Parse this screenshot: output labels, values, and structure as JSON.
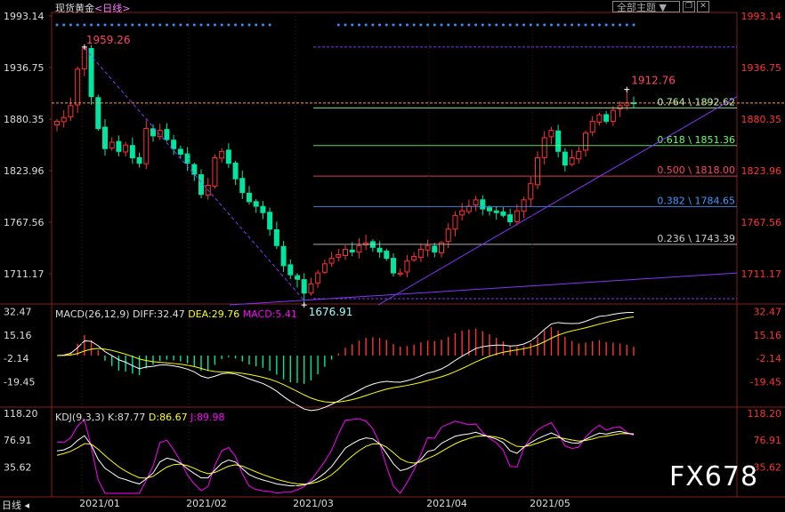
{
  "header": {
    "instrument": "现货黄金",
    "period": "<日线>",
    "menu_label": "全部主题",
    "menu_arrow": "▼",
    "period_tab": "日线"
  },
  "watermark": "FX678",
  "colors": {
    "up": "#ff3232",
    "down": "#00e6a0",
    "dif": "#ffffff",
    "dea": "#ffff00",
    "macd_label": "#ff00ff",
    "k": "#ffffff",
    "d": "#ffff00",
    "j": "#ff00ff",
    "trend": "#8833ff",
    "axis": "#ff3232"
  },
  "chart_data": [
    {
      "type": "candlestick",
      "title": "现货黄金<日线>",
      "ylim": [
        1680,
        1993.14
      ],
      "y_ticks": [
        "1993.14",
        "1936.75",
        "1880.35",
        "1823.96",
        "1767.56",
        "1711.17"
      ],
      "x_ticks": [
        "2021/01",
        "2021/02",
        "2021/03",
        "2021/04",
        "2021/05"
      ],
      "annotations": {
        "high": "1959.26",
        "low": "1676.91",
        "last_high": "1912.76"
      },
      "close_path": [
        1878,
        1882,
        1895,
        1935,
        1958,
        1905,
        1870,
        1848,
        1855,
        1845,
        1852,
        1838,
        1832,
        1870,
        1862,
        1868,
        1858,
        1848,
        1842,
        1832,
        1820,
        1798,
        1808,
        1838,
        1845,
        1832,
        1815,
        1800,
        1790,
        1785,
        1778,
        1760,
        1742,
        1720,
        1710,
        1705,
        1690,
        1700,
        1712,
        1722,
        1728,
        1732,
        1738,
        1735,
        1742,
        1745,
        1740,
        1735,
        1728,
        1712,
        1712,
        1725,
        1730,
        1738,
        1742,
        1735,
        1745,
        1760,
        1775,
        1780,
        1785,
        1792,
        1782,
        1780,
        1778,
        1775,
        1768,
        1780,
        1792,
        1810,
        1838,
        1860,
        1868,
        1845,
        1830,
        1838,
        1845,
        1865,
        1878,
        1885,
        1878,
        1890,
        1895,
        1898,
        1898
      ],
      "fibonacci": [
        {
          "label": "0.764 \\ 1892.62",
          "value": 1892.62,
          "color": "#b0ffb0"
        },
        {
          "label": "0.618 \\ 1851.36",
          "value": 1851.36,
          "color": "#66ff66"
        },
        {
          "label": "0.500 \\ 1818.00",
          "value": 1818.0,
          "color": "#ff4466"
        },
        {
          "label": "0.382 \\ 1784.65",
          "value": 1784.65,
          "color": "#4499ff"
        },
        {
          "label": "0.236 \\ 1743.39",
          "value": 1743.39,
          "color": "#cccccc"
        }
      ],
      "fib_top": 1959.26,
      "fib_bottom": 1680
    },
    {
      "type": "macd",
      "label_name": "MACD(26,12,9)",
      "dif_label": "DIFF:32.47",
      "dea_label": "DEA:29.76",
      "macd_label": "MACD:5.41",
      "y_ticks": [
        "32.47",
        "15.16",
        "-2.14",
        "-19.45"
      ],
      "ylim": [
        -38,
        36
      ]
    },
    {
      "type": "kdj",
      "label_name": "KDJ(9,3,3)",
      "k_label": "K:87.77",
      "d_label": "D:86.67",
      "j_label": "J:89.98",
      "y_ticks": [
        "118.20",
        "76.91",
        "35.62"
      ],
      "ylim": [
        -5,
        125
      ]
    }
  ]
}
